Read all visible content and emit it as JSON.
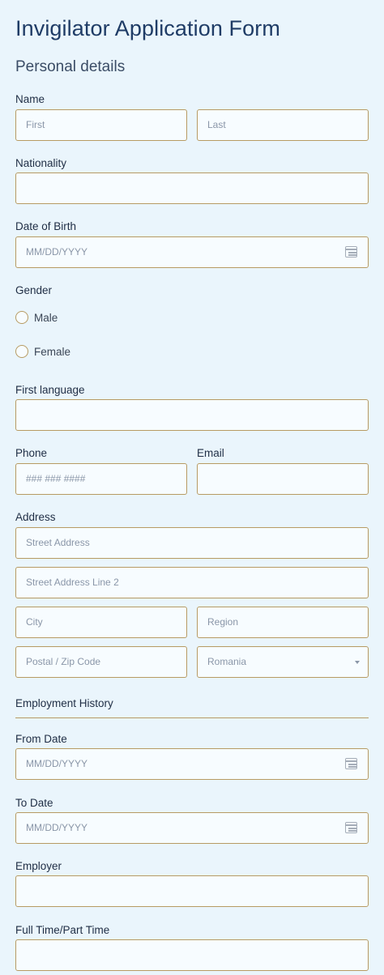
{
  "form": {
    "title": "Invigilator Application Form",
    "subtitle": "Personal details"
  },
  "name": {
    "label": "Name",
    "first_placeholder": "First",
    "last_placeholder": "Last"
  },
  "nationality": {
    "label": "Nationality"
  },
  "dob": {
    "label": "Date of Birth",
    "placeholder": "MM/DD/YYYY"
  },
  "gender": {
    "label": "Gender",
    "options": [
      "Male",
      "Female"
    ]
  },
  "first_language": {
    "label": "First language"
  },
  "phone": {
    "label": "Phone",
    "placeholder": "### ### ####"
  },
  "email": {
    "label": "Email"
  },
  "address": {
    "label": "Address",
    "street_placeholder": "Street Address",
    "street2_placeholder": "Street Address Line 2",
    "city_placeholder": "City",
    "region_placeholder": "Region",
    "postal_placeholder": "Postal / Zip Code",
    "country_value": "Romania"
  },
  "employment": {
    "heading": "Employment History",
    "from_label": "From Date",
    "from_placeholder": "MM/DD/YYYY",
    "to_label": "To Date",
    "to_placeholder": "MM/DD/YYYY",
    "employer_label": "Employer",
    "fulltime_label": "Full Time/Part Time"
  },
  "colors": {
    "background": "#eaf5fc",
    "field_border": "#b79b63",
    "title": "#1f3c66"
  }
}
